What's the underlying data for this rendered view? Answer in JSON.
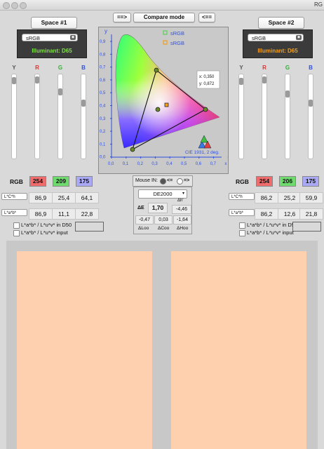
{
  "window": {
    "title": "RG"
  },
  "top": {
    "compare_left": "==>",
    "compare_mode": "Compare mode",
    "compare_right": "<=="
  },
  "left": {
    "space_button": "Space #1",
    "profile": "sRGB",
    "illuminant": "Illuminant: D65",
    "slider_labels": [
      "Y",
      "R",
      "G",
      "B"
    ],
    "rgb_label": "RGB",
    "rgb": [
      "254",
      "209",
      "175"
    ],
    "rgb_colors": [
      "#f06b6b",
      "#6fdb6f",
      "#a9a9f5"
    ],
    "lch_select": "L*C*h",
    "lch": [
      "86,9",
      "25,4",
      "64,1"
    ],
    "lab_select": "L*a*b*",
    "lab": [
      "86,9",
      "11,1",
      "22,8"
    ],
    "cb1": "L*a*b* / L*u*v* in D50",
    "cb2": "L*a*b* / L*u*v* input",
    "swatch": "#ffd0b0"
  },
  "right": {
    "space_button": "Space #2",
    "profile": "sRGB",
    "illuminant": "Illuminant: D65",
    "slider_labels": [
      "Y",
      "R",
      "G",
      "B"
    ],
    "rgb_label": "RGB",
    "rgb": [
      "254",
      "206",
      "175"
    ],
    "rgb_colors": [
      "#f06b6b",
      "#6fdb6f",
      "#a9a9f5"
    ],
    "lch_select": "L*C*h",
    "lch": [
      "86,2",
      "25,2",
      "59,9"
    ],
    "lab_select": "L*a*b*",
    "lab": [
      "86,2",
      "12,6",
      "21,8"
    ],
    "cb1": "L*a*b* / L*u*v* in D50",
    "cb2": "L*a*b* / L*u*v* input",
    "swatch": "#ffd0ad"
  },
  "chart": {
    "y_label": "y",
    "x_label": "x",
    "y_ticks": [
      "0,9",
      "0,8",
      "0,7",
      "0,6",
      "0,5",
      "0,4",
      "0,3",
      "0,2",
      "0,1",
      "0,0"
    ],
    "x_ticks": [
      "0,0",
      "0,1",
      "0,2",
      "0,3",
      "0,4",
      "0,5",
      "0,6",
      "0,7",
      "x"
    ],
    "legend": [
      "sRGB",
      "sRGB"
    ],
    "legend_colors": [
      "#5ad25a",
      "#f2a020"
    ],
    "readout_x": "x: 0,350",
    "readout_y": "y: 0,872",
    "caption": "CIE 1931, 2 deg."
  },
  "middle": {
    "mouse_in": "Mouse IN:",
    "radio_left": "<=",
    "radio_right": "=>",
    "formula": "DE2000",
    "de_label": "ΔE",
    "de_value": "1,70",
    "dh_label": "Δh'",
    "dh_value": "-4,46",
    "vals": [
      "-0,47",
      "0,03",
      "-1,64"
    ],
    "vals_labels": [
      "ΔLoo",
      "ΔCoo",
      "ΔHoo"
    ]
  }
}
